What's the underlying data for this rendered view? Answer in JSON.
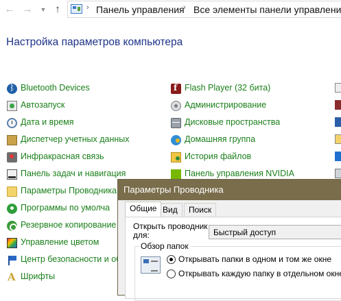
{
  "addressbar": {
    "back_icon": "arrow-left-icon",
    "forward_icon": "arrow-right-icon",
    "recent_icon": "chevron-down-icon",
    "up_icon": "arrow-up-icon",
    "crumbs": [
      "Панель управления",
      "Все элементы панели управления"
    ]
  },
  "heading": "Настройка параметров компьютера",
  "items_left": [
    {
      "label": "Bluetooth Devices",
      "icon": "bluetooth-icon"
    },
    {
      "label": "Автозапуск",
      "icon": "autorun-icon"
    },
    {
      "label": "Дата и время",
      "icon": "clock-icon"
    },
    {
      "label": "Диспетчер учетных данных",
      "icon": "credential-manager-icon"
    },
    {
      "label": "Инфракрасная связь",
      "icon": "infrared-icon"
    },
    {
      "label": "Панель задач и навигация",
      "icon": "taskbar-icon"
    },
    {
      "label": "Параметры Проводника",
      "icon": "folder-options-icon"
    },
    {
      "label": "Программы по умолча",
      "icon": "default-programs-icon"
    },
    {
      "label": "Резервное копирование и",
      "icon": "backup-icon"
    },
    {
      "label": "Управление цветом",
      "icon": "color-management-icon"
    },
    {
      "label": "Центр безопасности и об",
      "icon": "security-center-icon"
    },
    {
      "label": "Шрифты",
      "icon": "fonts-icon"
    }
  ],
  "items_mid": [
    {
      "label": "Flash Player (32 бита)",
      "icon": "flash-icon"
    },
    {
      "label": "Администрирование",
      "icon": "admin-tools-icon"
    },
    {
      "label": "Дисковые пространства",
      "icon": "storage-spaces-icon"
    },
    {
      "label": "Домашняя группа",
      "icon": "homegroup-icon"
    },
    {
      "label": "История файлов",
      "icon": "file-history-icon"
    },
    {
      "label": "Панель управления NVIDIA",
      "icon": "nvidia-icon"
    }
  ],
  "dialog": {
    "title": "Параметры Проводника",
    "tabs": [
      "Общие",
      "Вид",
      "Поиск"
    ],
    "open_label": "Открыть проводник для:",
    "open_value": "Быстрый доступ",
    "group_title": "Обзор папок",
    "radio_same": "Открывать папки в одном и том же окне",
    "radio_new": "Открывать каждую папку в отдельном окне"
  },
  "colors": {
    "heading": "#1e3287",
    "link": "#1a7f1a",
    "dialog_titlebar": "#7a6d4b"
  }
}
